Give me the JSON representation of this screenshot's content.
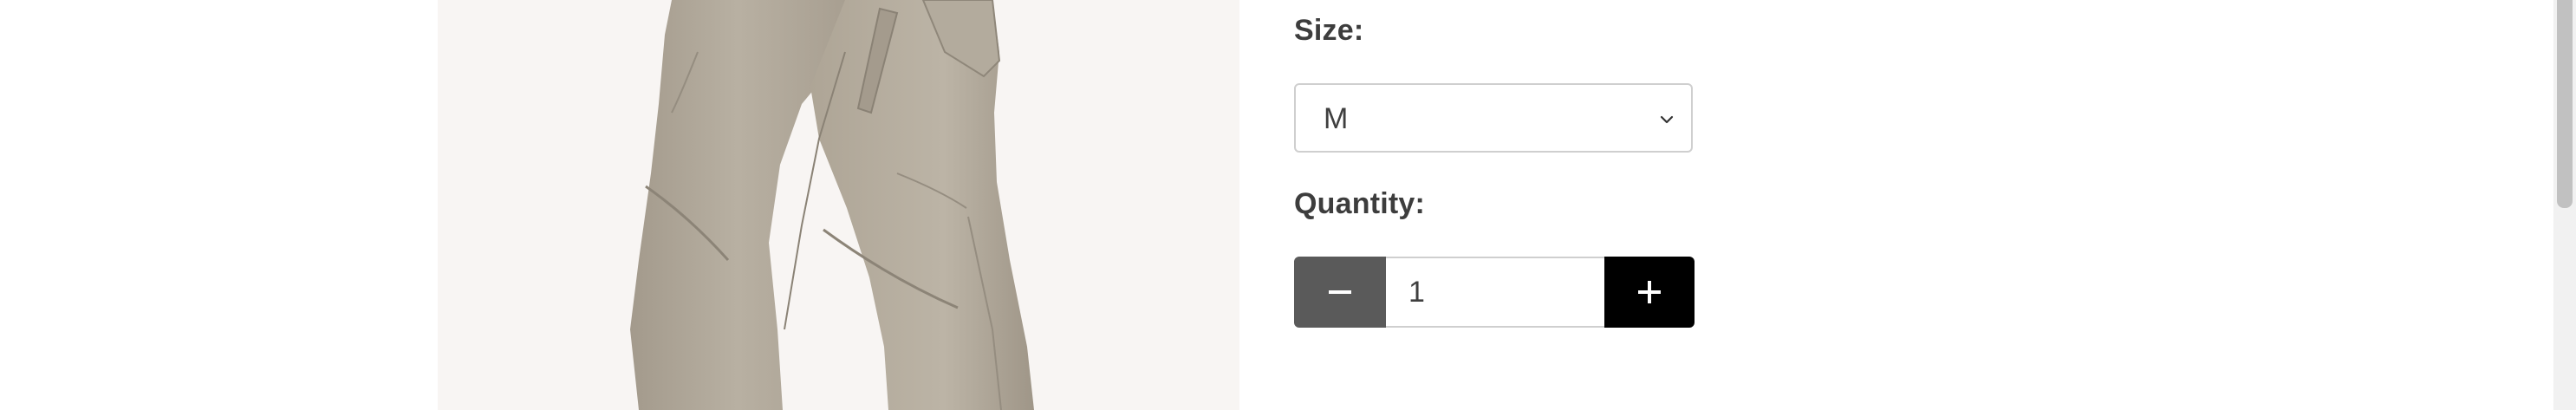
{
  "product_image": {
    "alt": "Khaki cargo pants",
    "background": "#f8f5f3"
  },
  "options": {
    "size": {
      "label": "Size:",
      "selected": "M",
      "icon": "chevron-down-icon"
    },
    "quantity": {
      "label": "Quantity:",
      "value": "1",
      "decrement_icon": "minus-icon",
      "increment_icon": "plus-icon"
    }
  },
  "colors": {
    "text": "#3d3d3d",
    "minus_button": "#5a5a5a",
    "plus_button": "#000000",
    "border": "#cfcfcf"
  }
}
